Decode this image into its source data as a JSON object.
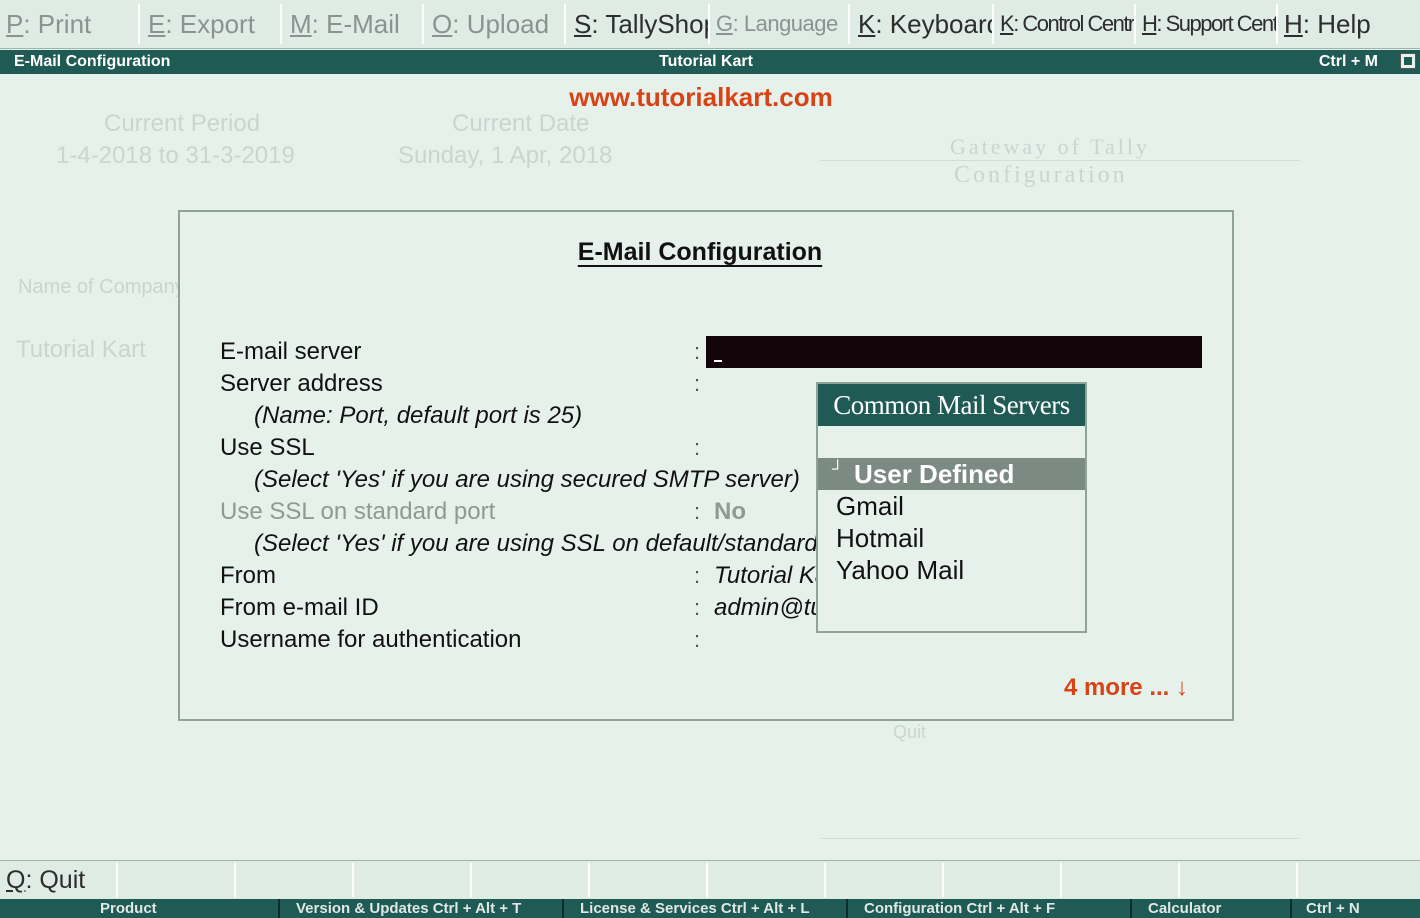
{
  "top_menu": [
    {
      "key": "P",
      "label": "Print",
      "enabled": false
    },
    {
      "key": "E",
      "label": "Export",
      "enabled": false
    },
    {
      "key": "M",
      "label": "E-Mail",
      "enabled": false
    },
    {
      "key": "O",
      "label": "Upload",
      "enabled": false
    },
    {
      "key": "S",
      "label": "TallyShop",
      "enabled": true
    },
    {
      "key": "G",
      "label": "Language",
      "enabled": false
    },
    {
      "key": "K",
      "label": "Keyboard",
      "enabled": true
    },
    {
      "key": "K",
      "label": "Control Centre",
      "enabled": true
    },
    {
      "key": "H",
      "label": "Support Centre",
      "enabled": true
    },
    {
      "key": "H",
      "label": "Help",
      "enabled": true
    }
  ],
  "title_bar": {
    "left": "E-Mail Configuration",
    "center": "Tutorial Kart",
    "right": "Ctrl + M"
  },
  "watermark": "www.tutorialkart.com",
  "background": {
    "period_label": "Current Period",
    "period_value": "1-4-2018 to 31-3-2019",
    "date_label": "Current Date",
    "date_value": "Sunday, 1 Apr, 2018",
    "menu_title_1": "Gateway of Tally",
    "menu_title_2": "Configuration",
    "company_header": "Name of Company",
    "company_name": "Tutorial Kart",
    "quit": "Quit"
  },
  "dialog": {
    "title": "E-Mail Configuration",
    "fields": [
      {
        "label": "E-mail server",
        "value": ""
      },
      {
        "label": "Server address",
        "value": ""
      },
      {
        "hint": "(Name: Port, default port is 25)"
      },
      {
        "label": "Use SSL",
        "value": ""
      },
      {
        "hint": "(Select 'Yes' if you are using secured SMTP server)"
      },
      {
        "label": "Use SSL on standard port",
        "value": "No",
        "disabled": true
      },
      {
        "hint": "(Select 'Yes' if you are using SSL on default/standard port)"
      },
      {
        "label": "From",
        "value": "Tutorial Kart"
      },
      {
        "label": "From e-mail ID",
        "value": "admin@tutorialkart.com"
      },
      {
        "label": "Username for authentication",
        "value": ""
      }
    ],
    "more": "4 more ... ↓"
  },
  "popup": {
    "title": "Common Mail Servers",
    "items": [
      "User Defined",
      "Gmail",
      "Hotmail",
      "Yahoo Mail"
    ],
    "selected_index": 0
  },
  "bottom_menu": [
    {
      "key": "Q",
      "label": "Quit"
    }
  ],
  "status_bar": [
    "Product",
    "Version & Updates  Ctrl + Alt + T",
    "License & Services  Ctrl + Alt + L",
    "Configuration   Ctrl + Alt + F",
    "Calculator",
    "Ctrl + N"
  ],
  "colors": {
    "bar": "#1f5a55",
    "background": "#e7f1ec",
    "accent": "#d84315",
    "selection": "#7c8a84"
  }
}
